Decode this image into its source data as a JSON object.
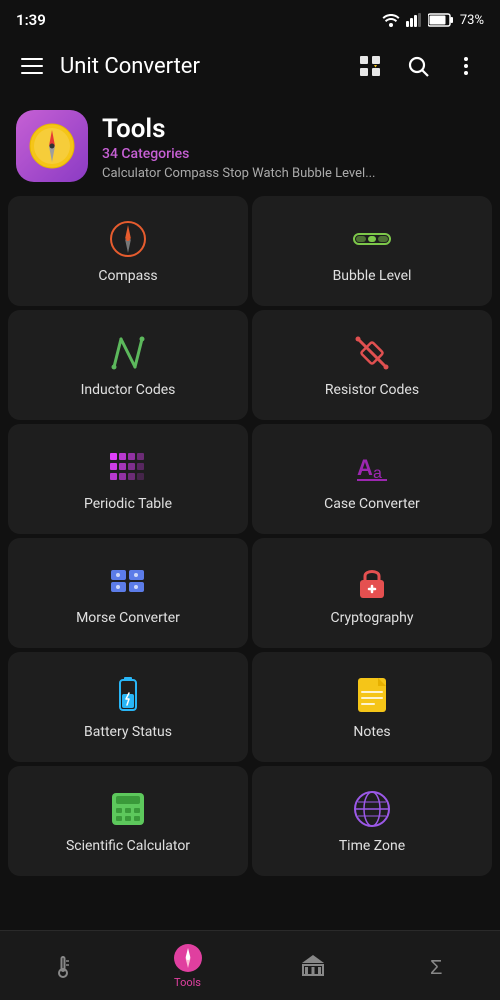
{
  "statusBar": {
    "time": "1:39",
    "battery": "73%"
  },
  "appBar": {
    "title": "Unit Converter",
    "menuIcon": "menu",
    "favoriteIcon": "favorite-grid",
    "searchIcon": "search",
    "moreIcon": "more-vertical"
  },
  "headerCard": {
    "title": "Tools",
    "subtitle": "34 Categories",
    "description": "Calculator Compass Stop Watch Bubble Level..."
  },
  "grid": {
    "items": [
      {
        "id": "compass",
        "label": "Compass",
        "color": "#e65c2e"
      },
      {
        "id": "bubble-level",
        "label": "Bubble Level",
        "color": "#7dc84a"
      },
      {
        "id": "inductor-codes",
        "label": "Inductor Codes",
        "color": "#5cb85c"
      },
      {
        "id": "resistor-codes",
        "label": "Resistor Codes",
        "color": "#e05050"
      },
      {
        "id": "periodic-table",
        "label": "Periodic Table",
        "color": "#e040fb"
      },
      {
        "id": "case-converter",
        "label": "Case Converter",
        "color": "#9c27b0"
      },
      {
        "id": "morse-converter",
        "label": "Morse Converter",
        "color": "#5c7ce8"
      },
      {
        "id": "cryptography",
        "label": "Cryptography",
        "color": "#e55050"
      },
      {
        "id": "battery-status",
        "label": "Battery Status",
        "color": "#29b6f6"
      },
      {
        "id": "notes",
        "label": "Notes",
        "color": "#f5c518"
      },
      {
        "id": "scientific-calculator",
        "label": "Scientific Calculator",
        "color": "#5dc85c"
      },
      {
        "id": "time-zone",
        "label": "Time Zone",
        "color": "#9c59e8"
      }
    ]
  },
  "bottomNav": {
    "items": [
      {
        "id": "thermometer",
        "label": "",
        "active": false
      },
      {
        "id": "tools",
        "label": "Tools",
        "active": true
      },
      {
        "id": "bank",
        "label": "",
        "active": false
      },
      {
        "id": "sigma",
        "label": "",
        "active": false
      }
    ]
  }
}
